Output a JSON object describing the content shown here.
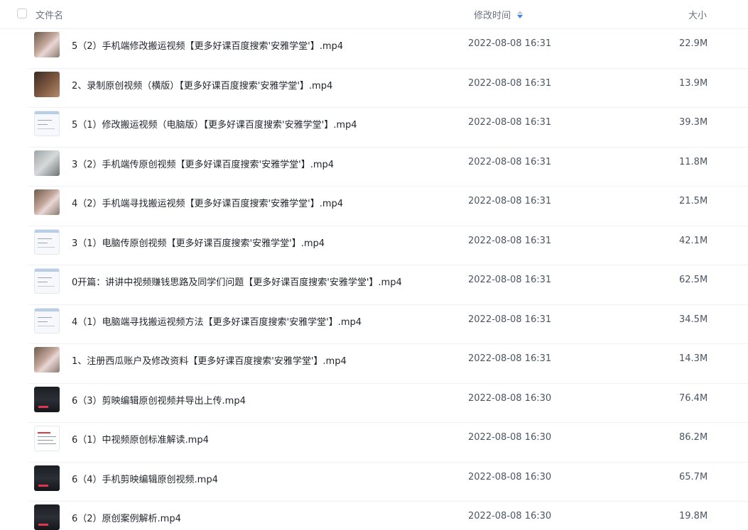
{
  "header": {
    "name_label": "文件名",
    "time_label": "修改时间",
    "size_label": "大小"
  },
  "files": [
    {
      "name": "5（2）手机端修改搬运视频【更多好课百度搜索'安雅学堂'】.mp4",
      "date": "2022-08-08 16:31",
      "size": "22.9M",
      "thumb": "phone"
    },
    {
      "name": "2、录制原创视频（横版）【更多好课百度搜索'安雅学堂'】.mp4",
      "date": "2022-08-08 16:31",
      "size": "13.9M",
      "thumb": "dark"
    },
    {
      "name": "5（1）修改搬运视频（电脑版）【更多好课百度搜索'安雅学堂'】.mp4",
      "date": "2022-08-08 16:31",
      "size": "39.3M",
      "thumb": "screen"
    },
    {
      "name": "3（2）手机端传原创视频【更多好课百度搜索'安雅学堂'】.mp4",
      "date": "2022-08-08 16:31",
      "size": "11.8M",
      "thumb": "grey"
    },
    {
      "name": "4（2）手机端寻找搬运视频【更多好课百度搜索'安雅学堂'】.mp4",
      "date": "2022-08-08 16:31",
      "size": "21.5M",
      "thumb": "phone"
    },
    {
      "name": "3（1）电脑传原创视频【更多好课百度搜索'安雅学堂'】.mp4",
      "date": "2022-08-08 16:31",
      "size": "42.1M",
      "thumb": "screen"
    },
    {
      "name": "0开篇：讲讲中视频赚钱思路及同学们问题【更多好课百度搜索'安雅学堂'】.mp4",
      "date": "2022-08-08 16:31",
      "size": "62.5M",
      "thumb": "screen"
    },
    {
      "name": "4（1）电脑端寻找搬运视频方法【更多好课百度搜索'安雅学堂'】.mp4",
      "date": "2022-08-08 16:31",
      "size": "34.5M",
      "thumb": "screen"
    },
    {
      "name": "1、注册西瓜账户及修改资料【更多好课百度搜索'安雅学堂'】.mp4",
      "date": "2022-08-08 16:31",
      "size": "14.3M",
      "thumb": "phone"
    },
    {
      "name": "6（3）剪映编辑原创视频并导出上传.mp4",
      "date": "2022-08-08 16:30",
      "size": "76.4M",
      "thumb": "video"
    },
    {
      "name": "6（1）中视频原创标准解读.mp4",
      "date": "2022-08-08 16:30",
      "size": "86.2M",
      "thumb": "doc"
    },
    {
      "name": "6（4）手机剪映编辑原创视频.mp4",
      "date": "2022-08-08 16:30",
      "size": "65.7M",
      "thumb": "video"
    },
    {
      "name": "6（2）原创案例解析.mp4",
      "date": "2022-08-08 16:30",
      "size": "19.8M",
      "thumb": "video"
    }
  ],
  "colors": {
    "sort_active": "#3b82f6",
    "header_text": "#6b7280",
    "row_divider": "#f0f1f4"
  }
}
